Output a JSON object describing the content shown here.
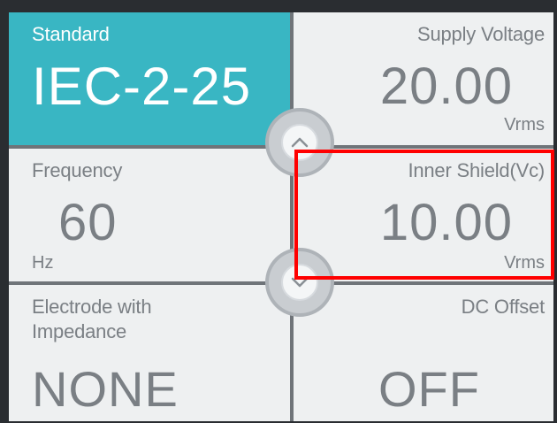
{
  "tiles": {
    "standard": {
      "label": "Standard",
      "value": "IEC-2-25"
    },
    "supply_voltage": {
      "label": "Supply Voltage",
      "value": "20.00",
      "unit": "Vrms"
    },
    "frequency": {
      "label": "Frequency",
      "value": "60",
      "unit": "Hz"
    },
    "inner_shield": {
      "label": "Inner Shield(Vc)",
      "value": "10.00",
      "unit": "Vrms"
    },
    "electrode": {
      "label_line1": "Electrode with",
      "label_line2": "Impedance",
      "value": "NONE"
    },
    "dc_offset": {
      "label": "DC Offset",
      "value": "OFF"
    }
  },
  "navigation": {
    "up_icon": "chevron-up-icon",
    "down_icon": "chevron-down-icon"
  },
  "colors": {
    "selected_tile": "#39b6c3",
    "tile_background": "#eef0f1",
    "text_gray": "#7a7f84",
    "highlight_box": "#ff0000"
  }
}
